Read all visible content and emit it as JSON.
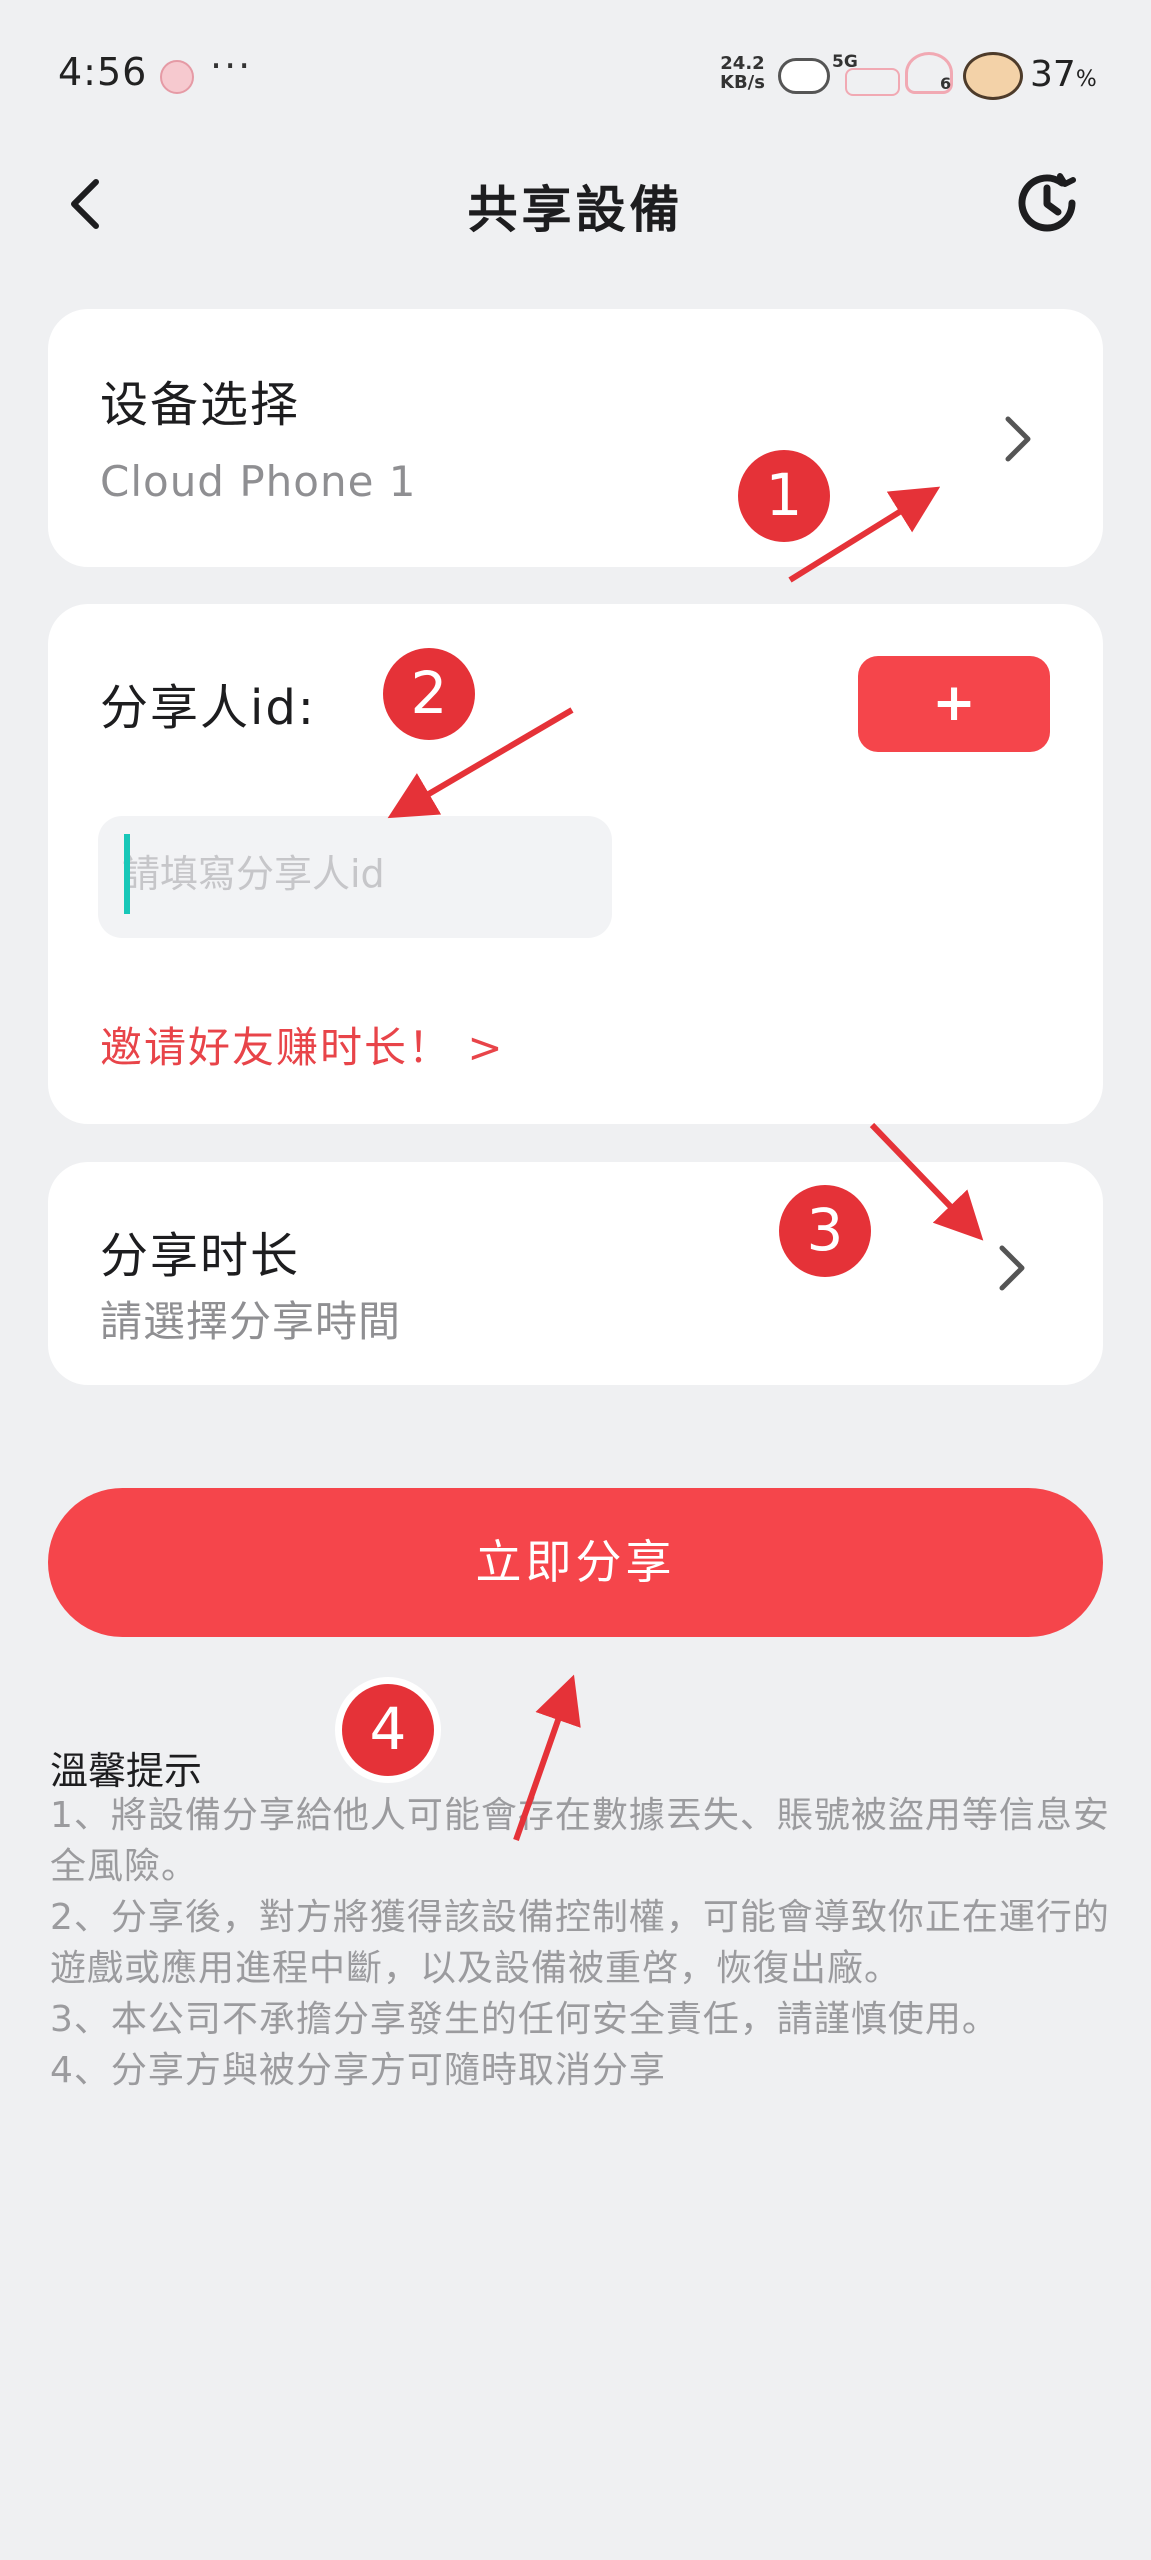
{
  "status_bar": {
    "time": "4:56",
    "more": "···",
    "net_speed_value": "24.2",
    "net_speed_unit": "KB/s",
    "network_type": "5G",
    "wifi_number": "6",
    "battery": "37",
    "battery_unit": "%"
  },
  "header": {
    "title": "共享設備",
    "back_icon": "chevron-left-icon",
    "history_icon": "history-clock-icon"
  },
  "device_card": {
    "label": "设备选择",
    "value": "Cloud Phone 1"
  },
  "share_card": {
    "label": "分享人id:",
    "add_button": "+",
    "input_placeholder": "請填寫分享人id",
    "input_value": "",
    "invite_link": "邀请好友赚时长！ >"
  },
  "duration_card": {
    "label": "分享时长",
    "placeholder": "請選擇分享時間"
  },
  "share_button": "立即分享",
  "tips": {
    "title": "溫馨提示",
    "items": [
      "1、將設備分享給他人可能會存在數據丟失、賬號被盜用等信息安全風險。",
      "2、分享後，對方將獲得該設備控制權，可能會導致你正在運行的遊戲或應用進程中斷，以及設備被重啓，恢復出廠。",
      "3、本公司不承擔分享發生的任何安全責任，請謹慎使用。",
      "4、分享方與被分享方可隨時取消分享"
    ]
  },
  "annotations": [
    "1",
    "2",
    "3",
    "4"
  ],
  "colors": {
    "accent": "#f5454b",
    "background": "#eff0f2",
    "annotation": "#e53238",
    "caret": "#18c7b8"
  }
}
